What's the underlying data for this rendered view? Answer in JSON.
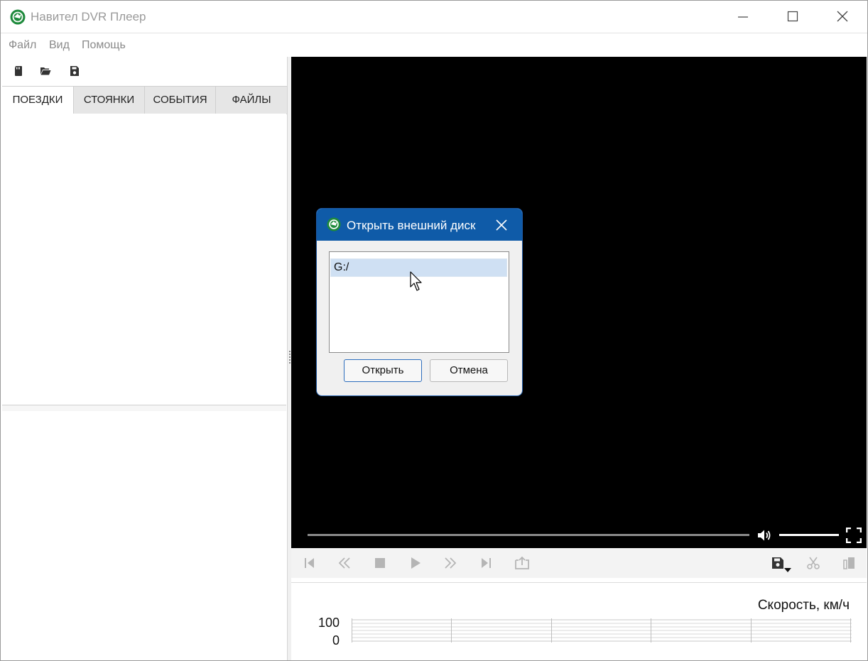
{
  "app": {
    "title": "Навител DVR Плеер"
  },
  "menu": {
    "items": [
      "Файл",
      "Вид",
      "Помощь"
    ]
  },
  "tabs": [
    "ПОЕЗДКИ",
    "СТОЯНКИ",
    "СОБЫТИЯ",
    "ФАЙЛЫ"
  ],
  "active_tab": "ПОЕЗДКИ",
  "dialog": {
    "title": "Открыть внешний диск",
    "items": [
      "G:/"
    ],
    "selected": "G:/",
    "open_label": "Открыть",
    "cancel_label": "Отмена"
  },
  "graph": {
    "title": "Скорость, км/ч",
    "ymax": "100",
    "ymin": "0"
  },
  "icons": {
    "toolbar": [
      "sd-card-icon",
      "folder-open-icon",
      "save-file-icon"
    ],
    "controls": [
      "skip-start-icon",
      "rewind-icon",
      "stop-icon",
      "play-icon",
      "fast-forward-icon",
      "skip-end-icon",
      "export-icon",
      "save-dropdown-icon",
      "scissors-icon",
      "copy-icon"
    ]
  },
  "colors": {
    "accent": "#0f5ba8",
    "brand_green": "#1e8a3c",
    "video_bg": "#000000"
  }
}
